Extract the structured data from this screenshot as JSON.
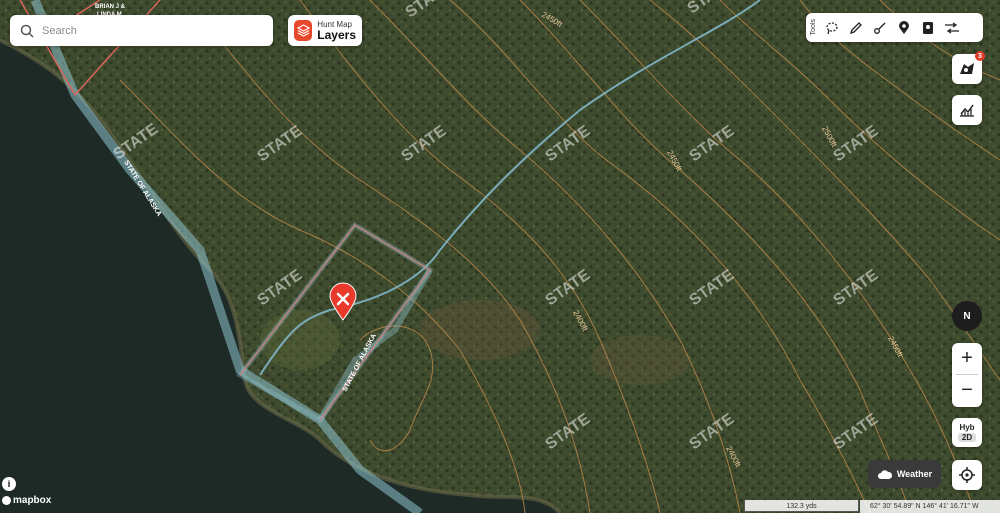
{
  "search": {
    "placeholder": "Search"
  },
  "layers_button": {
    "subtitle": "Hunt Map",
    "label": "Layers"
  },
  "toolbar": {
    "label": "Tools",
    "icons": [
      "lasso-icon",
      "pen-icon",
      "measure-icon",
      "pin-icon",
      "book-icon",
      "route-icon"
    ]
  },
  "notifications": {
    "count": "3"
  },
  "compass": {
    "label": "N"
  },
  "zoom": {
    "in": "+",
    "out": "−"
  },
  "map_mode": {
    "style": "Hyb",
    "view": "2D"
  },
  "weather": {
    "label": "Weather"
  },
  "attribution": {
    "info": "i",
    "brand": "mapbox"
  },
  "scale": {
    "label": "132.3 yds"
  },
  "coordinates": {
    "text": "62° 30' 54.89\" N 146° 41' 16.71\" W"
  },
  "map_labels": {
    "owner_top": "BRIAN J &",
    "owner_top2": "LINDA M",
    "state_of_alaska_1": "STATE OF ALASKA",
    "state_of_alaska_2": "STATE OF ALASKA",
    "state": "STATE",
    "contour_2450_top": "2450ft",
    "contour_2450_mid": "2450ft",
    "contour_2500": "2500ft",
    "contour_2400_mid": "2400ft",
    "contour_2450_right": "2450ft",
    "contour_2400_bottom": "2400ft"
  },
  "colors": {
    "forest": "#3e4a2d",
    "water": "#1d2a26",
    "parcel": "#d9655a",
    "boundary": "#8ec3d0",
    "marker": "#e8392b",
    "contour": "#b8864a"
  }
}
